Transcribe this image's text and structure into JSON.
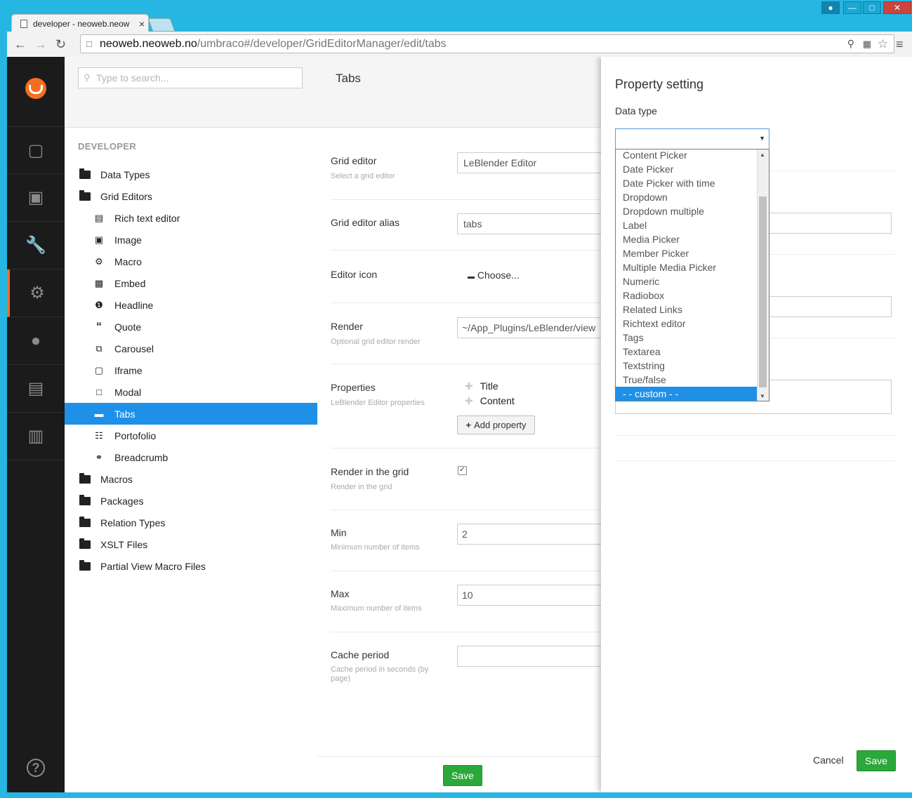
{
  "browser": {
    "tab_title": "developer - neoweb.neow",
    "url_host": "neoweb.neoweb.no",
    "url_path": "/umbraco#/developer/GridEditorManager/edit/tabs"
  },
  "tree": {
    "search_placeholder": "Type to search...",
    "section_label": "DEVELOPER",
    "items": [
      {
        "label": "Data Types",
        "type": "folder",
        "indent": 0
      },
      {
        "label": "Grid Editors",
        "type": "folder",
        "indent": 0
      },
      {
        "label": "Rich text editor",
        "type": "item",
        "indent": 1,
        "icon": "rte-icon"
      },
      {
        "label": "Image",
        "type": "item",
        "indent": 1,
        "icon": "image-icon"
      },
      {
        "label": "Macro",
        "type": "item",
        "indent": 1,
        "icon": "cogs-icon"
      },
      {
        "label": "Embed",
        "type": "item",
        "indent": 1,
        "icon": "film-icon"
      },
      {
        "label": "Headline",
        "type": "item",
        "indent": 1,
        "icon": "headline-icon"
      },
      {
        "label": "Quote",
        "type": "item",
        "indent": 1,
        "icon": "quote-icon"
      },
      {
        "label": "Carousel",
        "type": "item",
        "indent": 1,
        "icon": "carousel-icon"
      },
      {
        "label": "Iframe",
        "type": "item",
        "indent": 1,
        "icon": "iframe-icon"
      },
      {
        "label": "Modal",
        "type": "item",
        "indent": 1,
        "icon": "window-icon"
      },
      {
        "label": "Tabs",
        "type": "item",
        "indent": 1,
        "icon": "tabs-icon",
        "selected": true
      },
      {
        "label": "Portofolio",
        "type": "item",
        "indent": 1,
        "icon": "list-icon"
      },
      {
        "label": "Breadcrumb",
        "type": "item",
        "indent": 1,
        "icon": "link-icon"
      },
      {
        "label": "Macros",
        "type": "folder",
        "indent": 0
      },
      {
        "label": "Packages",
        "type": "folder",
        "indent": 0
      },
      {
        "label": "Relation Types",
        "type": "folder",
        "indent": 0
      },
      {
        "label": "XSLT Files",
        "type": "folder",
        "indent": 0
      },
      {
        "label": "Partial View Macro Files",
        "type": "folder",
        "indent": 0
      }
    ]
  },
  "editor": {
    "title": "Tabs",
    "grid_editor": {
      "label": "Grid editor",
      "desc": "Select a grid editor",
      "value": "LeBlender Editor"
    },
    "alias": {
      "label": "Grid editor alias",
      "value": "tabs"
    },
    "icon": {
      "label": "Editor icon",
      "choose": "Choose..."
    },
    "render": {
      "label": "Render",
      "desc": "Optional grid editor render",
      "value": "~/App_Plugins/LeBlender/view"
    },
    "properties": {
      "label": "Properties",
      "desc": "LeBlender Editor properties",
      "items": [
        "Title",
        "Content"
      ],
      "add": "Add property"
    },
    "render_grid": {
      "label": "Render in the grid",
      "desc": "Render in the grid",
      "checked": true
    },
    "min": {
      "label": "Min",
      "desc": "Minimum number of items",
      "value": "2"
    },
    "max": {
      "label": "Max",
      "desc": "Maximum number of items",
      "value": "10"
    },
    "cache": {
      "label": "Cache period",
      "desc": "Cache period in seconds (by page)",
      "value": ""
    },
    "save": "Save"
  },
  "dialog": {
    "title": "Property setting",
    "data_type_label": "Data type",
    "options": [
      "Content Picker",
      "Date Picker",
      "Date Picker with time",
      "Dropdown",
      "Dropdown multiple",
      "Label",
      "Media Picker",
      "Member Picker",
      "Multiple Media Picker",
      "Numeric",
      "Radiobox",
      "Related Links",
      "Richtext editor",
      "Tags",
      "Textarea",
      "Textstring",
      "True/false",
      "- - custom - -"
    ],
    "highlighted_index": 17,
    "cancel": "Cancel",
    "save": "Save"
  },
  "colors": {
    "accent": "#1e90e8",
    "brand": "#f36f21",
    "save": "#2ba83a"
  }
}
